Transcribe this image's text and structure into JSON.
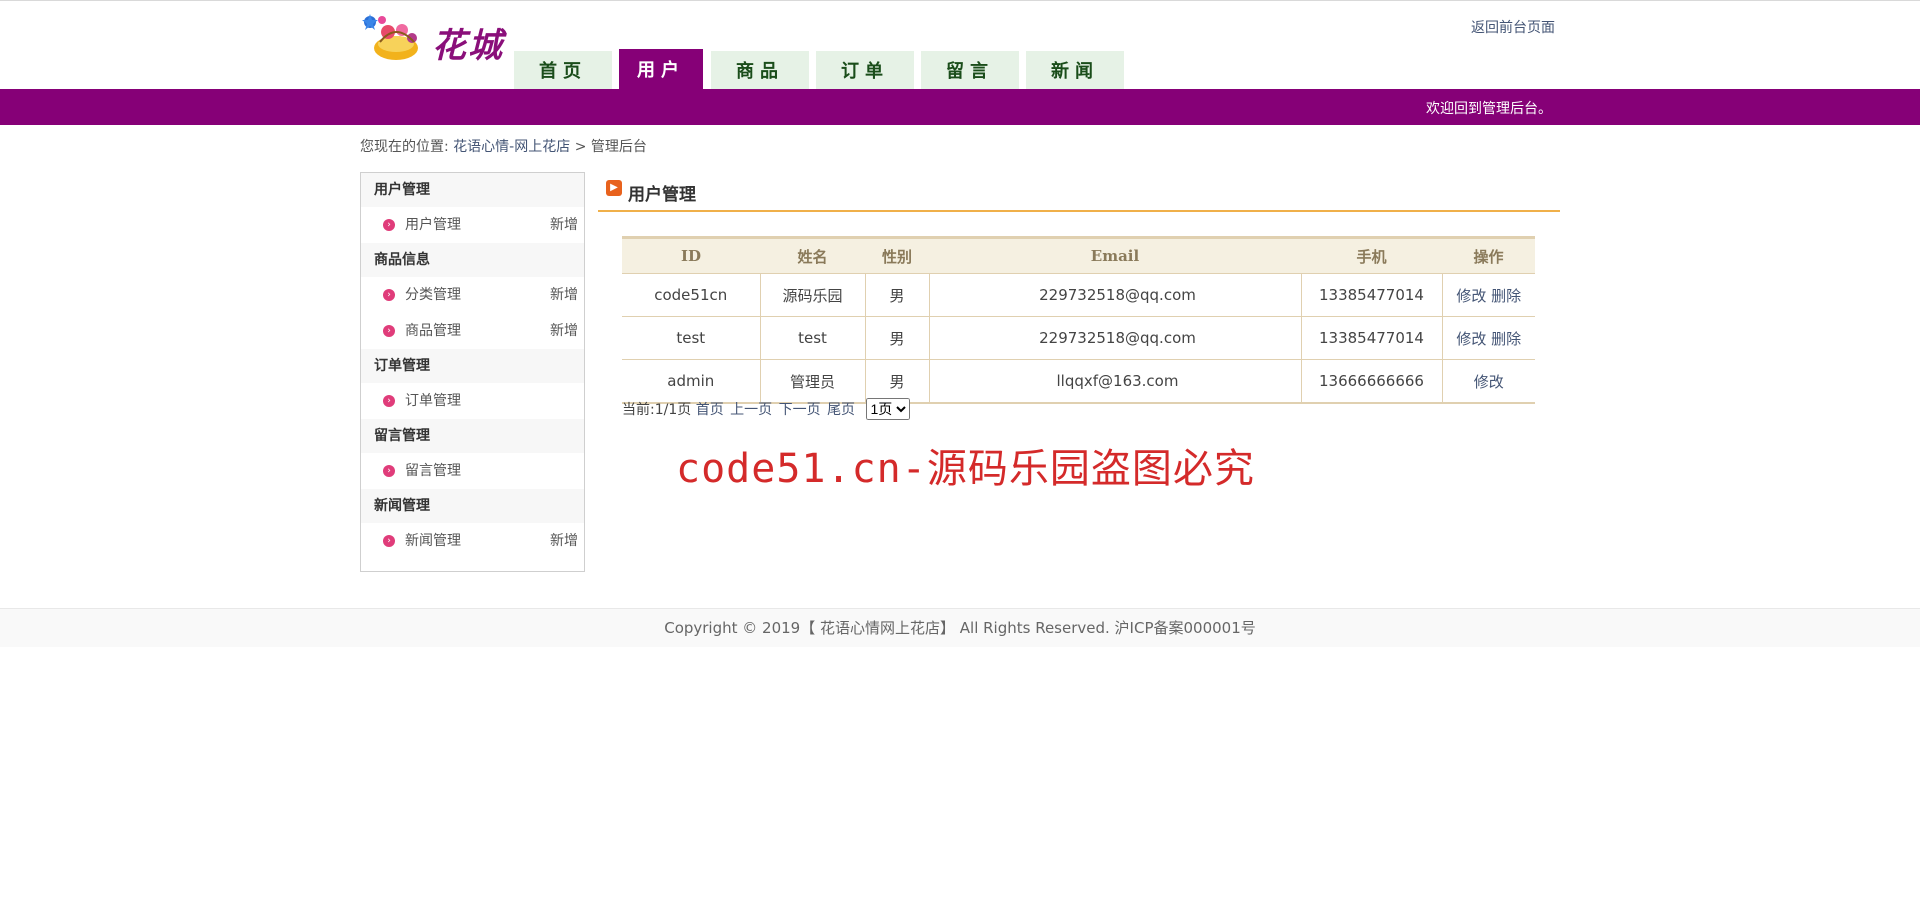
{
  "header": {
    "logo_text": "花城",
    "back_link": "返回前台页面",
    "nav": [
      {
        "label": "首页"
      },
      {
        "label": "用户",
        "active": true
      },
      {
        "label": "商品"
      },
      {
        "label": "订单"
      },
      {
        "label": "留言"
      },
      {
        "label": "新闻"
      }
    ],
    "welcome": "欢迎回到管理后台。"
  },
  "breadcrumb": {
    "prefix": "您现在的位置:",
    "link": "花语心情-网上花店",
    "separator": ">",
    "current": "管理后台"
  },
  "sidebar": {
    "groups": [
      {
        "title": "用户管理",
        "items": [
          {
            "label": "用户管理",
            "action": "新增"
          }
        ]
      },
      {
        "title": "商品信息",
        "items": [
          {
            "label": "分类管理",
            "action": "新增"
          },
          {
            "label": "商品管理",
            "action": "新增"
          }
        ]
      },
      {
        "title": "订单管理",
        "items": [
          {
            "label": "订单管理",
            "action": ""
          }
        ]
      },
      {
        "title": "留言管理",
        "items": [
          {
            "label": "留言管理",
            "action": ""
          }
        ]
      },
      {
        "title": "新闻管理",
        "items": [
          {
            "label": "新闻管理",
            "action": "新增"
          }
        ]
      }
    ]
  },
  "main": {
    "title": "用户管理",
    "table": {
      "headers": [
        "ID",
        "姓名",
        "性别",
        "Email",
        "手机",
        "操作"
      ],
      "rows": [
        {
          "id": "code51cn",
          "name": "源码乐园",
          "gender": "男",
          "email": "229732518@qq.com",
          "phone": "13385477014",
          "edit": "修改",
          "delete": "删除"
        },
        {
          "id": "test",
          "name": "test",
          "gender": "男",
          "email": "229732518@qq.com",
          "phone": "13385477014",
          "edit": "修改",
          "delete": "删除"
        },
        {
          "id": "admin",
          "name": "管理员",
          "gender": "男",
          "email": "llqqxf@163.com",
          "phone": "13666666666",
          "edit": "修改",
          "delete": ""
        }
      ]
    },
    "pager": {
      "current": "当前:1/1页",
      "first": "首页",
      "prev": "上一页",
      "next": "下一页",
      "last": "尾页",
      "select_value": "1页"
    },
    "watermark": "code51.cn-源码乐园盗图必究"
  },
  "footer": {
    "text": "Copyright © 2019【 花语心情网上花店】 All Rights Reserved. 沪ICP备案000001号"
  },
  "colors": {
    "brand_purple": "#860077",
    "nav_tab_bg": "#e6f2e6",
    "title_underline": "#f0b04a",
    "watermark_red": "#d42a2a"
  }
}
